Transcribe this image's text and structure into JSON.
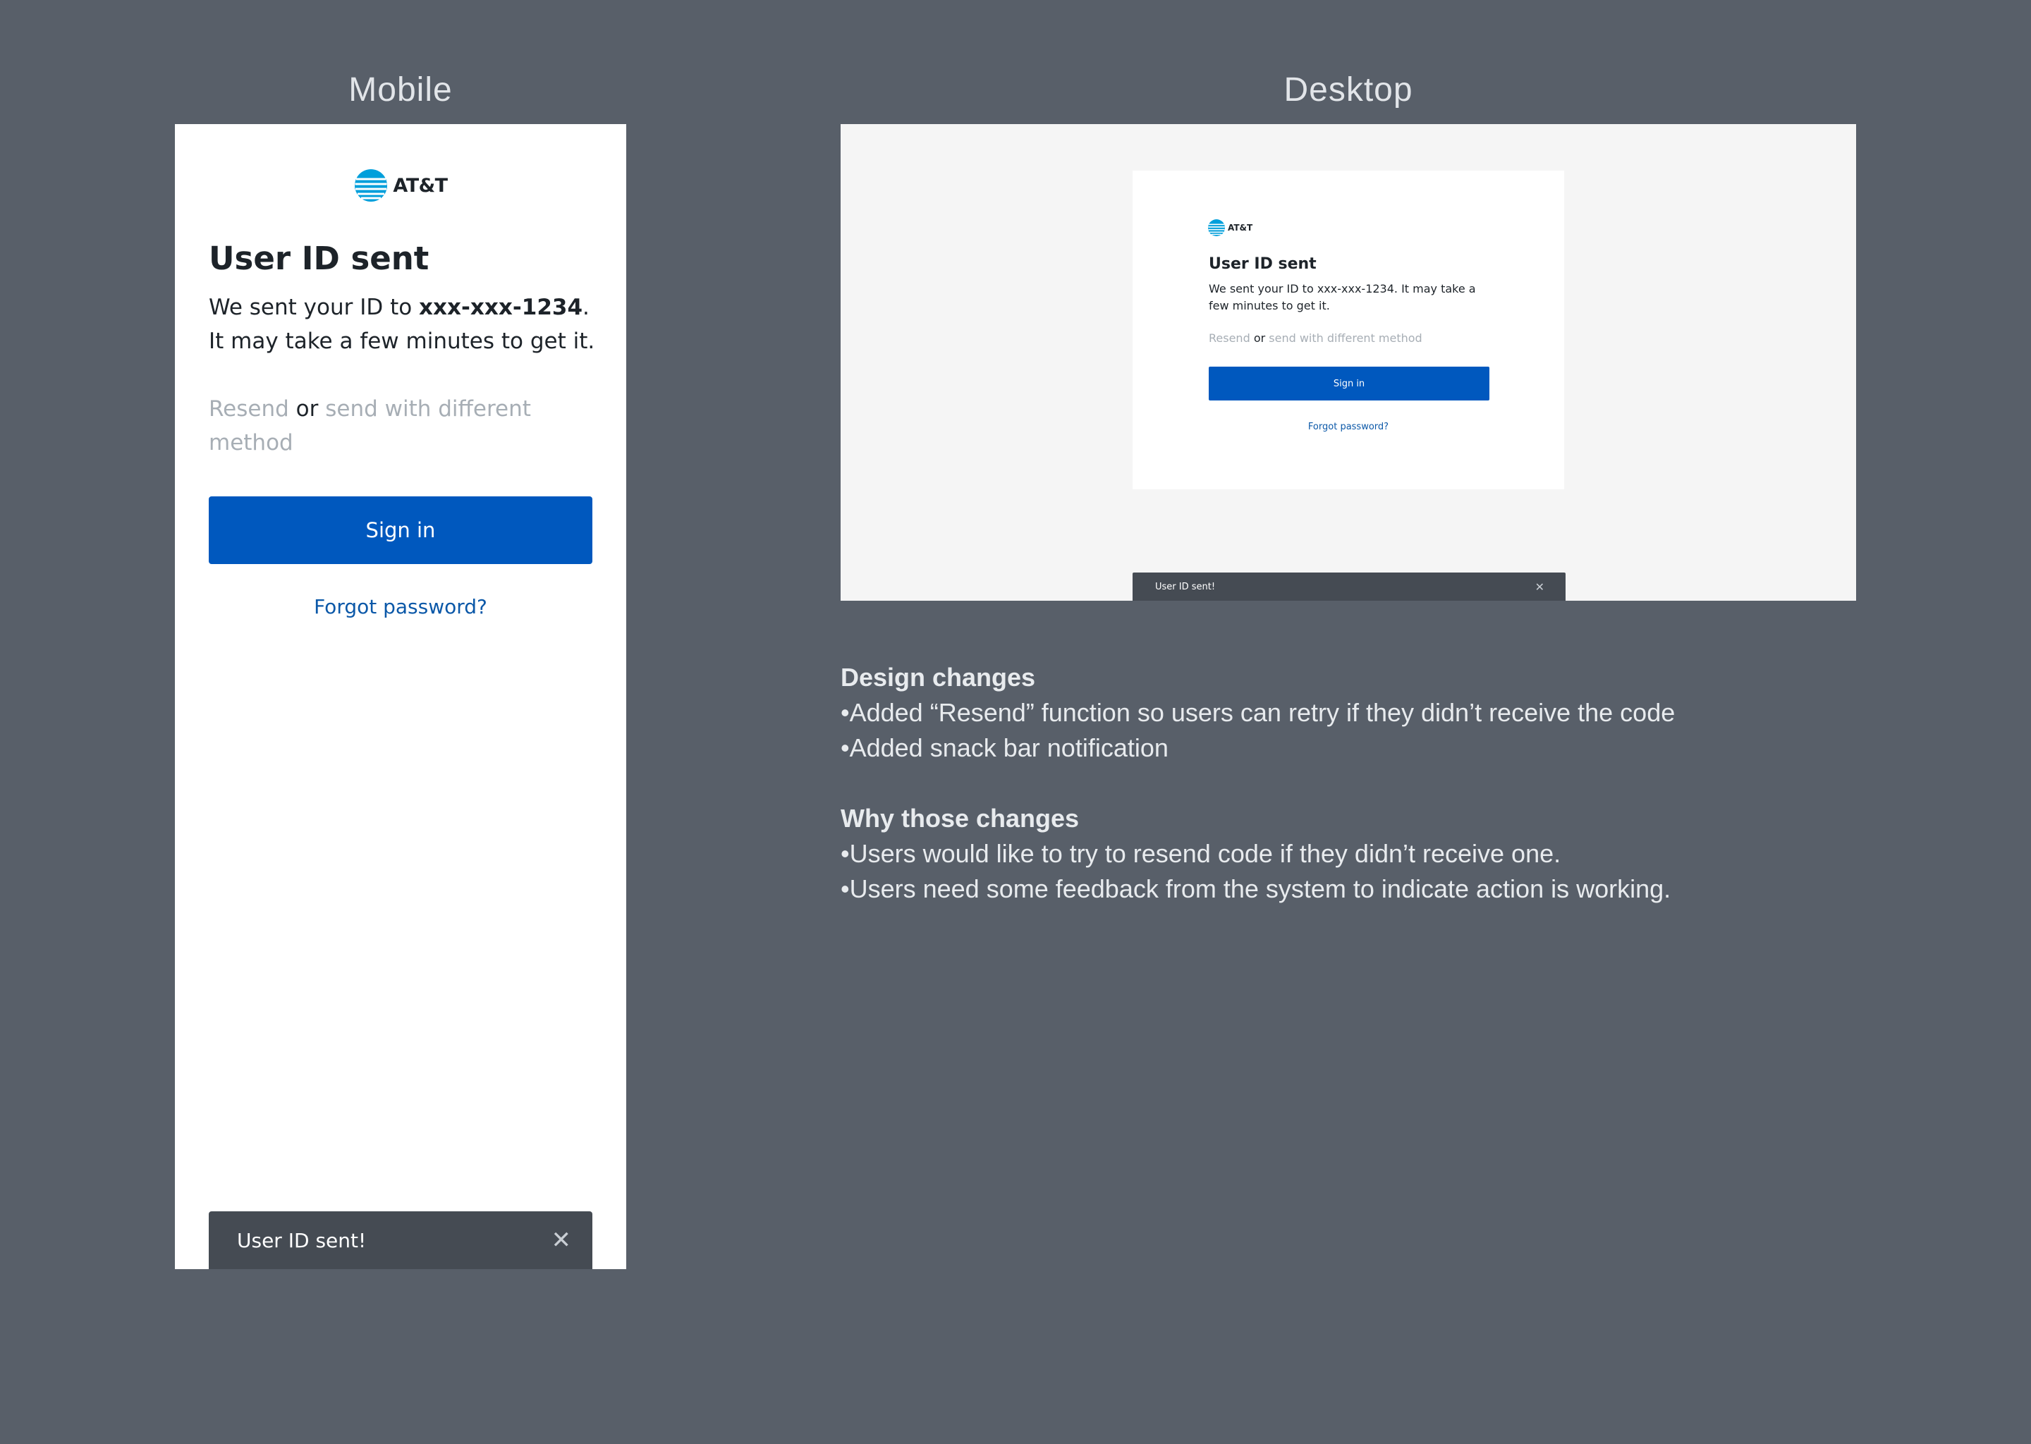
{
  "sections": {
    "mobile_label": "Mobile",
    "desktop_label": "Desktop"
  },
  "brand": {
    "logo_text": "AT&T",
    "accent_color": "#0058be",
    "globe_color": "#009fdb"
  },
  "screen": {
    "title": "User ID sent",
    "body_prefix": "We sent your ID to ",
    "phone": "xxx-xxx-1234",
    "body_suffix": ". It may take a few minutes to get it.",
    "resend_label": "Resend",
    "or_text": "or",
    "different_method_label": "send with different method",
    "sign_in_label": "Sign in",
    "forgot_password_label": "Forgot password?",
    "snackbar_text": "User ID sent!",
    "snackbar_close_icon": "close-icon"
  },
  "notes": {
    "design_title": "Design changes",
    "design_items": [
      "•Added “Resend” function so users can retry if they didn’t receive the code",
      "•Added snack bar notification"
    ],
    "why_title": "Why those changes",
    "why_items": [
      "•Users would like to try to resend code if they didn’t receive one.",
      "•Users need some feedback from the system to indicate action is working."
    ]
  }
}
